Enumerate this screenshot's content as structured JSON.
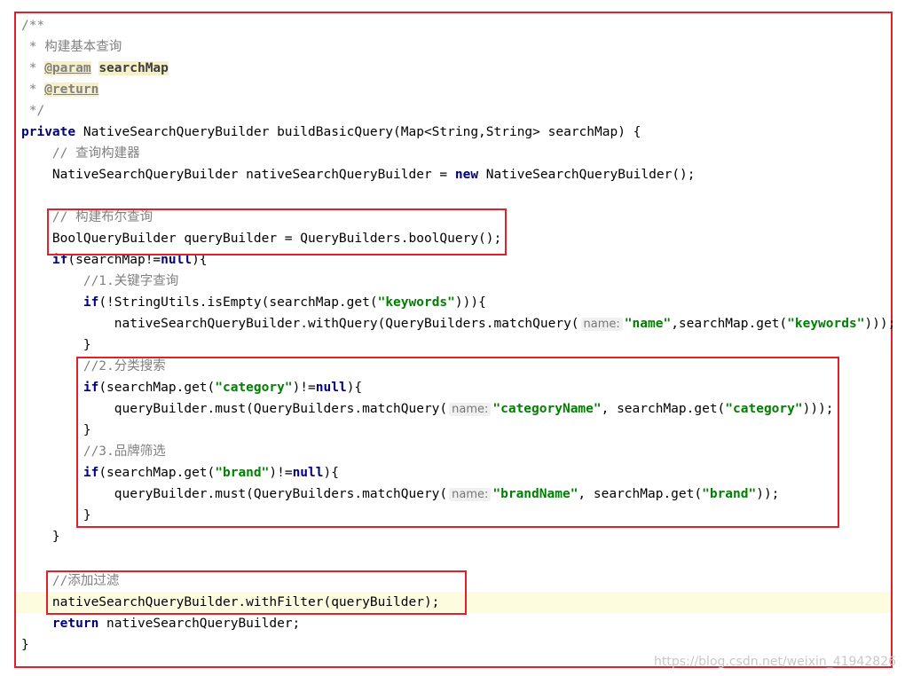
{
  "lines": {
    "l1": "/**",
    "l2": " * 构建基本查询",
    "l3_prefix": " * ",
    "l3_tag": "@param",
    "l3_name": "searchMap",
    "l4_prefix": " * ",
    "l4_tag": "@return",
    "l5": " */",
    "l6_kw": "private",
    "l6_rest": " NativeSearchQueryBuilder buildBasicQuery(Map<String,String> searchMap) {",
    "l7": "    // 查询构建器",
    "l8_a": "    NativeSearchQueryBuilder nativeSearchQueryBuilder = ",
    "l8_kw": "new",
    "l8_b": " NativeSearchQueryBuilder();",
    "l10": "    // 构建布尔查询",
    "l11": "    BoolQueryBuilder queryBuilder = QueryBuilders.boolQuery();",
    "l12_a": "    ",
    "l12_kw": "if",
    "l12_b": "(searchMap!=",
    "l12_kw2": "null",
    "l12_c": "){",
    "l13": "        //1.关键字查询",
    "l14_a": "        ",
    "l14_kw": "if",
    "l14_b": "(!StringUtils.isEmpty(searchMap.get(",
    "l14_str": "\"keywords\"",
    "l14_c": "))){",
    "l15_a": "            nativeSearchQueryBuilder.withQuery(QueryBuilders.matchQuery(",
    "l15_hint": "name:",
    "l15_str": "\"name\"",
    "l15_b": ",searchMap.get(",
    "l15_str2": "\"keywords\"",
    "l15_c": ")));",
    "l16": "        }",
    "l17": "        //2.分类搜索",
    "l18_a": "        ",
    "l18_kw": "if",
    "l18_b": "(searchMap.get(",
    "l18_str": "\"category\"",
    "l18_c": ")!=",
    "l18_kw2": "null",
    "l18_d": "){",
    "l19_a": "            queryBuilder.must(QueryBuilders.matchQuery(",
    "l19_hint": "name:",
    "l19_str": "\"categoryName\"",
    "l19_b": ", searchMap.get(",
    "l19_str2": "\"category\"",
    "l19_c": ")));",
    "l20": "        }",
    "l21": "        //3.品牌筛选",
    "l22_a": "        ",
    "l22_kw": "if",
    "l22_b": "(searchMap.get(",
    "l22_str": "\"brand\"",
    "l22_c": ")!=",
    "l22_kw2": "null",
    "l22_d": "){",
    "l23_a": "            queryBuilder.must(QueryBuilders.matchQuery(",
    "l23_hint": "name:",
    "l23_str": "\"brandName\"",
    "l23_b": ", searchMap.get(",
    "l23_str2": "\"brand\"",
    "l23_c": "));",
    "l24": "        }",
    "l25": "    }",
    "l27": "    //添加过滤",
    "l28": "    nativeSearchQueryBuilder.withFilter(queryBuilder);",
    "l29_a": "    ",
    "l29_kw": "return",
    "l29_b": " nativeSearchQueryBuilder;",
    "l30": "}"
  },
  "watermark": "https://blog.csdn.net/weixin_41942826",
  "colors": {
    "border": "#e0202b",
    "keyword": "#000080",
    "string": "#008000",
    "comment": "#808080",
    "highlight": "#fdfbe0"
  }
}
